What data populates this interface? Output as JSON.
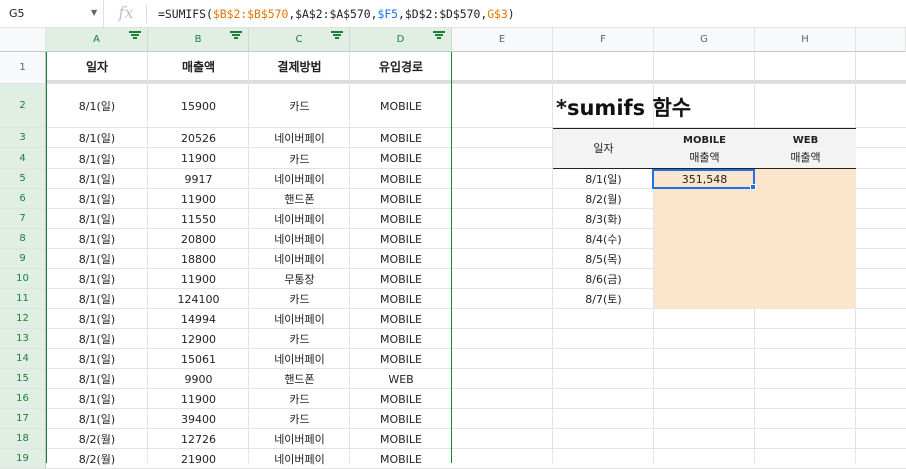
{
  "name_box": "G5",
  "formula_bar": {
    "fx_icon": "fx",
    "formula": {
      "prefix": "=SUMIFS(",
      "arg1": "$B$2:$B$570",
      "sep1": ",$A$2:$A$570,",
      "arg3": "$F5",
      "sep2": ",$D$2:$D$570,",
      "arg5": "G$3",
      "suffix": ")"
    }
  },
  "columns": [
    "A",
    "B",
    "C",
    "D",
    "E",
    "F",
    "G",
    "H"
  ],
  "rows": [
    "1",
    "2",
    "3",
    "4",
    "5",
    "6",
    "7",
    "8",
    "9",
    "10",
    "11",
    "12",
    "13",
    "14",
    "15",
    "16",
    "17",
    "18",
    "19"
  ],
  "headers": [
    "일자",
    "매출액",
    "결제방법",
    "유입경로"
  ],
  "data": [
    [
      "8/1(일)",
      "15900",
      "카드",
      "MOBILE"
    ],
    [
      "8/1(일)",
      "20526",
      "네이버페이",
      "MOBILE"
    ],
    [
      "8/1(일)",
      "11900",
      "카드",
      "MOBILE"
    ],
    [
      "8/1(일)",
      "9917",
      "네이버페이",
      "MOBILE"
    ],
    [
      "8/1(일)",
      "11900",
      "핸드폰",
      "MOBILE"
    ],
    [
      "8/1(일)",
      "11550",
      "네이버페이",
      "MOBILE"
    ],
    [
      "8/1(일)",
      "20800",
      "네이버페이",
      "MOBILE"
    ],
    [
      "8/1(일)",
      "18800",
      "네이버페이",
      "MOBILE"
    ],
    [
      "8/1(일)",
      "11900",
      "무통장",
      "MOBILE"
    ],
    [
      "8/1(일)",
      "124100",
      "카드",
      "MOBILE"
    ],
    [
      "8/1(일)",
      "14994",
      "네이버페이",
      "MOBILE"
    ],
    [
      "8/1(일)",
      "12900",
      "카드",
      "MOBILE"
    ],
    [
      "8/1(일)",
      "15061",
      "네이버페이",
      "MOBILE"
    ],
    [
      "8/1(일)",
      "9900",
      "핸드폰",
      "WEB"
    ],
    [
      "8/1(일)",
      "11900",
      "카드",
      "MOBILE"
    ],
    [
      "8/1(일)",
      "39400",
      "카드",
      "MOBILE"
    ],
    [
      "8/2(월)",
      "12726",
      "네이버페이",
      "MOBILE"
    ],
    [
      "8/2(월)",
      "21900",
      "네이버페이",
      "MOBILE"
    ]
  ],
  "summary": {
    "title": "*sumifs 함수",
    "date_header": "일자",
    "mobile_header": "MOBILE",
    "web_header": "WEB",
    "amount_label": "매출액",
    "dates": [
      "8/1(일)",
      "8/2(월)",
      "8/3(화)",
      "8/4(수)",
      "8/5(목)",
      "8/6(금)",
      "8/7(토)"
    ],
    "active_value": "351,548"
  },
  "colors": {
    "selection": "#1a73e8",
    "peach_fill": "#fce5cd",
    "filter_green": "#188038",
    "ref_orange": "#e37400",
    "ref_blue": "#1a73e8"
  }
}
